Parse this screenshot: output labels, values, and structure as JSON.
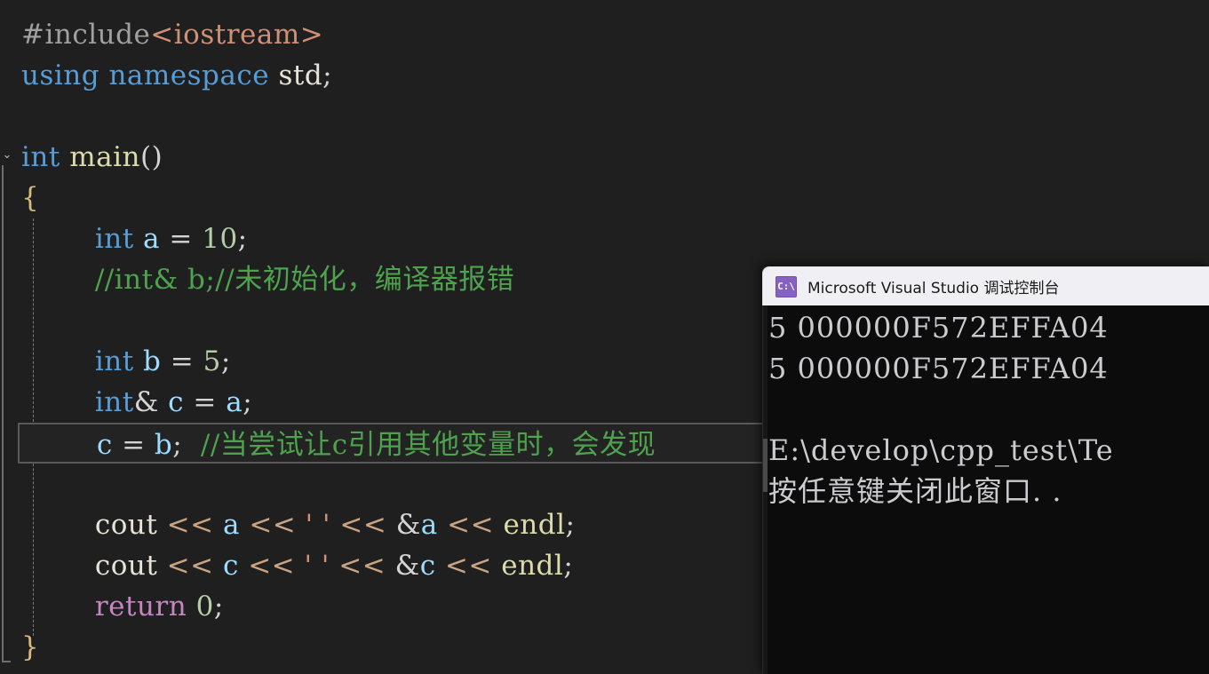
{
  "editor": {
    "name": "code-editor",
    "background": "#1f1f1f",
    "collapse_chevron": "⌄",
    "lines": [
      {
        "id": "l1",
        "indent": 0,
        "current": false,
        "tokens": [
          {
            "t": "#include",
            "c": "pp"
          },
          {
            "t": "<iostream>",
            "c": "str"
          }
        ]
      },
      {
        "id": "l2",
        "indent": 0,
        "current": false,
        "tokens": [
          {
            "t": "using namespace",
            "c": "kw"
          },
          {
            "t": " ",
            "c": "punct"
          },
          {
            "t": "std",
            "c": "plain"
          },
          {
            "t": ";",
            "c": "punct"
          }
        ]
      },
      {
        "id": "l3",
        "indent": 0,
        "current": false,
        "tokens": []
      },
      {
        "id": "l4",
        "indent": 0,
        "current": false,
        "tokens": [
          {
            "t": "int",
            "c": "kw"
          },
          {
            "t": " ",
            "c": "punct"
          },
          {
            "t": "main",
            "c": "fn"
          },
          {
            "t": "()",
            "c": "punct"
          }
        ]
      },
      {
        "id": "l5",
        "indent": 0,
        "current": false,
        "tokens": [
          {
            "t": "{",
            "c": "brace"
          }
        ]
      },
      {
        "id": "l6",
        "indent": 2,
        "current": false,
        "tokens": [
          {
            "t": "int",
            "c": "kw"
          },
          {
            "t": " ",
            "c": "punct"
          },
          {
            "t": "a",
            "c": "var"
          },
          {
            "t": " = ",
            "c": "punct"
          },
          {
            "t": "10",
            "c": "num"
          },
          {
            "t": ";",
            "c": "punct"
          }
        ]
      },
      {
        "id": "l7",
        "indent": 2,
        "current": false,
        "tokens": [
          {
            "t": "//int& b;//未初始化，编译器报错",
            "c": "cmt"
          }
        ]
      },
      {
        "id": "l8",
        "indent": 2,
        "current": false,
        "tokens": []
      },
      {
        "id": "l9",
        "indent": 2,
        "current": false,
        "tokens": [
          {
            "t": "int",
            "c": "kw"
          },
          {
            "t": " ",
            "c": "punct"
          },
          {
            "t": "b",
            "c": "var"
          },
          {
            "t": " = ",
            "c": "punct"
          },
          {
            "t": "5",
            "c": "num"
          },
          {
            "t": ";",
            "c": "punct"
          }
        ]
      },
      {
        "id": "l10",
        "indent": 2,
        "current": false,
        "tokens": [
          {
            "t": "int",
            "c": "kw"
          },
          {
            "t": "&",
            "c": "punct"
          },
          {
            "t": " ",
            "c": "punct"
          },
          {
            "t": "c",
            "c": "var"
          },
          {
            "t": " = ",
            "c": "punct"
          },
          {
            "t": "a",
            "c": "var"
          },
          {
            "t": ";",
            "c": "punct"
          }
        ]
      },
      {
        "id": "l11",
        "indent": 2,
        "current": true,
        "tokens": [
          {
            "t": "c",
            "c": "var"
          },
          {
            "t": " = ",
            "c": "punct"
          },
          {
            "t": "b",
            "c": "var"
          },
          {
            "t": ";  ",
            "c": "punct"
          },
          {
            "t": "//当尝试让c引用其他变量时，会发现",
            "c": "cmt"
          }
        ]
      },
      {
        "id": "l12",
        "indent": 2,
        "current": false,
        "tokens": []
      },
      {
        "id": "l13",
        "indent": 2,
        "current": false,
        "tokens": [
          {
            "t": "cout",
            "c": "plain"
          },
          {
            "t": " ",
            "c": "punct"
          },
          {
            "t": "<<",
            "c": "op"
          },
          {
            "t": " ",
            "c": "punct"
          },
          {
            "t": "a",
            "c": "var"
          },
          {
            "t": " ",
            "c": "punct"
          },
          {
            "t": "<<",
            "c": "op"
          },
          {
            "t": " ",
            "c": "punct"
          },
          {
            "t": "' '",
            "c": "str"
          },
          {
            "t": " ",
            "c": "punct"
          },
          {
            "t": "<<",
            "c": "op"
          },
          {
            "t": " &",
            "c": "punct"
          },
          {
            "t": "a",
            "c": "var"
          },
          {
            "t": " ",
            "c": "punct"
          },
          {
            "t": "<<",
            "c": "op"
          },
          {
            "t": " ",
            "c": "punct"
          },
          {
            "t": "endl",
            "c": "fn"
          },
          {
            "t": ";",
            "c": "punct"
          }
        ]
      },
      {
        "id": "l14",
        "indent": 2,
        "current": false,
        "tokens": [
          {
            "t": "cout",
            "c": "plain"
          },
          {
            "t": " ",
            "c": "punct"
          },
          {
            "t": "<<",
            "c": "op"
          },
          {
            "t": " ",
            "c": "punct"
          },
          {
            "t": "c",
            "c": "var"
          },
          {
            "t": " ",
            "c": "punct"
          },
          {
            "t": "<<",
            "c": "op"
          },
          {
            "t": " ",
            "c": "punct"
          },
          {
            "t": "' '",
            "c": "str"
          },
          {
            "t": " ",
            "c": "punct"
          },
          {
            "t": "<<",
            "c": "op"
          },
          {
            "t": " &",
            "c": "punct"
          },
          {
            "t": "c",
            "c": "var"
          },
          {
            "t": " ",
            "c": "punct"
          },
          {
            "t": "<<",
            "c": "op"
          },
          {
            "t": " ",
            "c": "punct"
          },
          {
            "t": "endl",
            "c": "fn"
          },
          {
            "t": ";",
            "c": "punct"
          }
        ]
      },
      {
        "id": "l15",
        "indent": 2,
        "current": false,
        "tokens": [
          {
            "t": "return",
            "c": "ctl"
          },
          {
            "t": " ",
            "c": "punct"
          },
          {
            "t": "0",
            "c": "num"
          },
          {
            "t": ";",
            "c": "punct"
          }
        ]
      },
      {
        "id": "l16",
        "indent": 0,
        "current": false,
        "tokens": [
          {
            "t": "}",
            "c": "brace"
          }
        ]
      }
    ]
  },
  "console": {
    "title": "Microsoft Visual Studio 调试控制台",
    "icon_label": "C:\\",
    "titlebar_color": "#f0f0f4",
    "body_color": "#0c0c0c",
    "lines": [
      "5 000000F572EFFA04",
      "5 000000F572EFFA04",
      "",
      "E:\\develop\\cpp_test\\Te",
      "按任意键关闭此窗口. ."
    ]
  }
}
